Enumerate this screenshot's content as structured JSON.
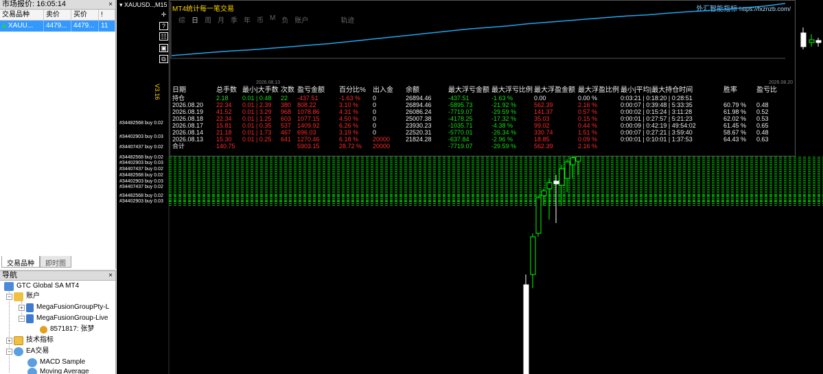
{
  "market_watch": {
    "title": "市场报价: 16:05:14",
    "close": "×",
    "columns": [
      "交易品种",
      "卖价",
      "买价",
      "!"
    ],
    "row": {
      "symbol": "XAUU...",
      "bid": "4479...",
      "ask": "4479...",
      "spread": "11"
    },
    "tabs": [
      "交易品种",
      "即时图"
    ]
  },
  "navigator": {
    "title": "导航",
    "close": "×",
    "items": [
      {
        "label": "GTC Global SA MT4"
      },
      {
        "label": "账户"
      },
      {
        "label": "MegaFusionGroupPty-L"
      },
      {
        "label": "MegaFusionGroup-Live"
      },
      {
        "label": "8571817: 张梦"
      },
      {
        "label": "技术指标"
      },
      {
        "label": "EA交易"
      },
      {
        "label": "MACD Sample"
      },
      {
        "label": "Moving Average"
      }
    ]
  },
  "chart": {
    "title": "XAUUSD..,M15",
    "tools": [
      "✛",
      "?",
      "☷",
      "▣",
      "⧉"
    ],
    "side_label": "V3.16",
    "trade_labels": [
      "#34482568 buy 0.02",
      "#34402903 buy 0.03",
      "#34407437 buy 0.02"
    ],
    "colors": {
      "bull": "#00ff00",
      "bear": "#ffffff",
      "background": "#000000"
    }
  },
  "stats": {
    "title": "MT4统计每一笔交易",
    "brand": "外汇智能指标",
    "brand_url": "https://fxznzb.com/",
    "tabs": [
      "综",
      "日",
      "周",
      "月",
      "季",
      "年",
      "币",
      "M",
      "负",
      "账户",
      "轨迹"
    ],
    "active_tab": "日",
    "equity_dates": [
      "2026.08.13",
      "2026.08.20"
    ],
    "equity_curve": [
      0.0,
      0.03,
      0.06,
      0.09,
      0.11,
      0.14,
      0.17,
      0.2,
      0.23,
      0.27,
      0.31,
      0.35,
      0.39,
      0.43,
      0.47,
      0.51,
      0.54,
      0.57,
      0.61,
      0.64,
      0.67,
      0.7,
      0.73,
      0.76,
      0.78,
      0.81,
      0.84,
      0.86,
      0.89,
      0.92,
      0.95,
      1.0
    ],
    "headers": [
      "日期",
      "总手数",
      "最小|大手数",
      "次数",
      "盈亏金额",
      "百分比%",
      "出入金",
      "余额",
      "最大浮亏金额",
      "最大浮亏比例",
      "最大浮盈金额",
      "最大浮盈比例",
      "最小|平均|最大持仓时间",
      "胜率",
      "盈亏比"
    ],
    "rows": [
      {
        "type": "hold",
        "cells": [
          "持仓",
          "2.18",
          "0.01 | 0.48",
          "22",
          "-437.51",
          "-1.63 %",
          "0",
          "26894.46",
          "-437.51",
          "-1.63 %",
          "0.00",
          "0.00 %",
          "0:03:21 | 0:18:20 | 0:28:51",
          "",
          ""
        ]
      },
      {
        "type": "day",
        "cells": [
          "2026.08.20",
          "22.34",
          "0.01 | 2.39",
          "380",
          "808.22",
          "3.10 %",
          "0",
          "26894.46",
          "-5895.73",
          "-21.92 %",
          "562.39",
          "2.16 %",
          "0:00:07 | 0:39:48 | 5:33:35",
          "60.79 %",
          "0.48"
        ]
      },
      {
        "type": "day",
        "cells": [
          "2026.08.19",
          "41.52",
          "0.01 | 3.29",
          "968",
          "1078.86",
          "4.31 %",
          "0",
          "26086.24",
          "-7719.07",
          "-29.59 %",
          "141.37",
          "0.57 %",
          "0:00:02 | 0:15:24 | 3:11:28",
          "61.98 %",
          "0.52"
        ]
      },
      {
        "type": "day",
        "cells": [
          "2026.08.18",
          "22.34",
          "0.01 | 1.25",
          "603",
          "1077.15",
          "4.50 %",
          "0",
          "25007.38",
          "-4178.25",
          "-17.32 %",
          "35.03",
          "0.15 %",
          "0:00:01 | 0:27:57 | 5:21:23",
          "62.02 %",
          "0.53"
        ]
      },
      {
        "type": "day",
        "cells": [
          "2026.08.17",
          "15.81",
          "0.01 | 0.35",
          "537",
          "1409.92",
          "6.26 %",
          "0",
          "23930.23",
          "-1035.71",
          "-4.38 %",
          "99.02",
          "0.44 %",
          "0:00:09 | 0:42:19 | 49:54:02",
          "61.45 %",
          "0.65"
        ]
      },
      {
        "type": "day",
        "cells": [
          "2026.08.14",
          "21.18",
          "0.01 | 1.73",
          "467",
          "696.03",
          "3.19 %",
          "0",
          "22520.31",
          "-5770.01",
          "-26.34 %",
          "330.74",
          "1.51 %",
          "0:00:07 | 0:27:21 | 3:59:40",
          "58.67 %",
          "0.48"
        ]
      },
      {
        "type": "day",
        "cells": [
          "2026.08.13",
          "15.30",
          "0.01 | 0.25",
          "641",
          "1270.46",
          "6.18 %",
          "20000",
          "21824.28",
          "-637.84",
          "-2.96 %",
          "18.85",
          "0.09 %",
          "0:00:01 | 0:10:01 | 1:37:53",
          "64.43 %",
          "0.63"
        ]
      },
      {
        "type": "total",
        "cells": [
          "合计",
          "140.75",
          "",
          "",
          "5903.15",
          "28.72 %",
          "20000",
          "",
          "-7719.07",
          "-29.59 %",
          "562.39",
          "2.16 %",
          "",
          "",
          ""
        ]
      }
    ]
  }
}
